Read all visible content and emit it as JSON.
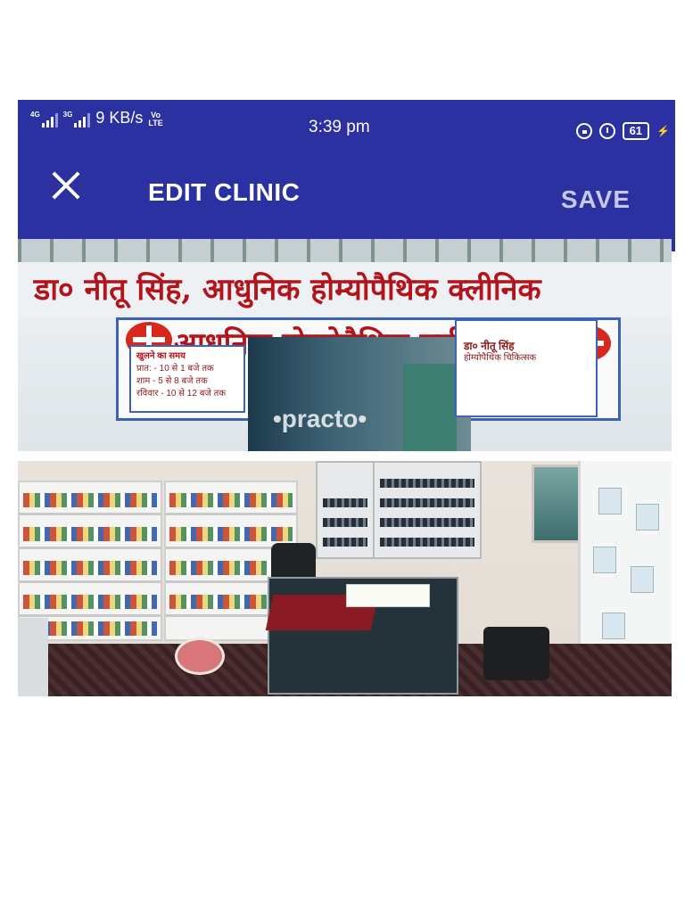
{
  "status_bar": {
    "net1": "4G",
    "net2": "3G",
    "speed": "9 KB/s",
    "volte_top": "Vo",
    "volte_bottom": "LTE",
    "time": "3:39 pm",
    "battery": "61"
  },
  "toolbar": {
    "title": "EDIT CLINIC",
    "save_label": "SAVE"
  },
  "photo1": {
    "sign_main": "डा० नीतू सिंह, आधुनिक होम्योपैथिक क्लीनिक",
    "sign_second": "आधुनिक होम्योपैथिक क्लीनिक",
    "timing_title": "खुलने का समय",
    "timing_morning": "प्रात: - 10 से 1 बजे तक",
    "timing_evening": "शाम - 5 से 8 बजे तक",
    "timing_sunday": "रविवार - 10 से 12 बजे तक",
    "plate_name": "डा० नीतू सिंह",
    "plate_role": "होम्योपैथिक चिकित्सक",
    "watermark": "•practo•"
  }
}
